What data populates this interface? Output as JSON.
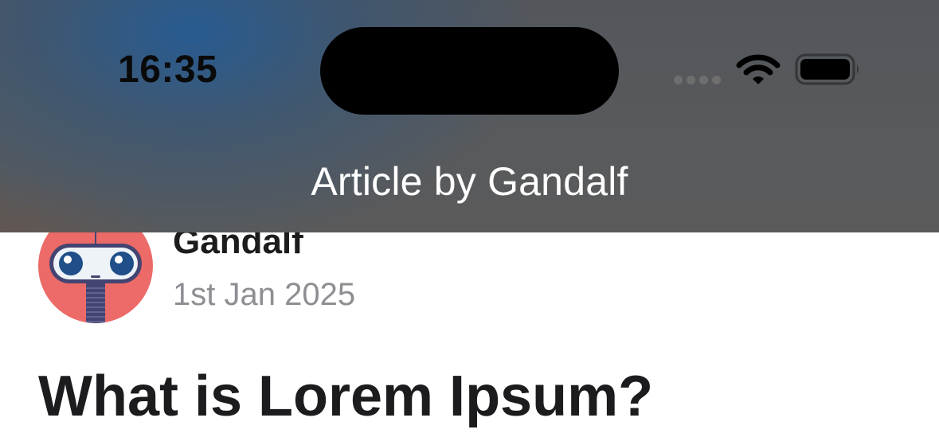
{
  "status_bar": {
    "time": "16:35",
    "icons": [
      "cellular-signal-icon",
      "wifi-icon",
      "battery-icon"
    ]
  },
  "nav": {
    "title": "Article by Gandalf"
  },
  "article": {
    "author": "Gandalf",
    "date": "1st Jan 2025",
    "title": "What is Lorem Ipsum?",
    "avatar_icon": "robot-avatar-icon"
  },
  "colors": {
    "avatar_background": "#EC6A67",
    "robot_eye": "#1F4E89",
    "robot_body": "#434472",
    "secondary_text": "#8E8E93",
    "primary_text": "#1C1C1E"
  }
}
